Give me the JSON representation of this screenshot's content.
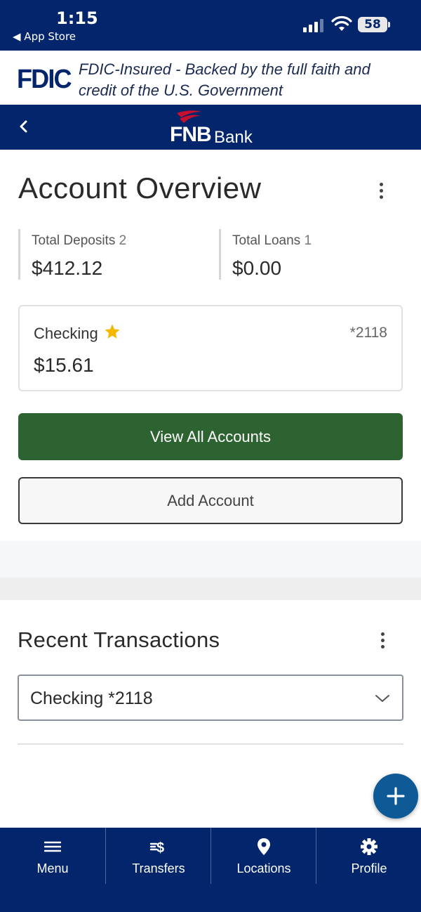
{
  "status_bar": {
    "time": "1:15",
    "back_label": "◀ App Store",
    "battery": "58"
  },
  "fdic": {
    "logo": "FDIC",
    "text": "FDIC-Insured - Backed by the full faith and credit of the U.S. Government"
  },
  "header": {
    "brand_primary": "FNB",
    "brand_secondary": "Bank"
  },
  "overview": {
    "title": "Account Overview",
    "deposits": {
      "label": "Total Deposits",
      "count": "2",
      "value": "$412.12"
    },
    "loans": {
      "label": "Total Loans",
      "count": "1",
      "value": "$0.00"
    },
    "account": {
      "name": "Checking",
      "number": "*2118",
      "balance": "$15.61",
      "favorite": true
    },
    "view_all_label": "View All Accounts",
    "add_account_label": "Add Account"
  },
  "recent": {
    "title": "Recent Transactions",
    "selected_account": "Checking *2118"
  },
  "tabs": [
    {
      "label": "Menu",
      "icon": "menu-icon"
    },
    {
      "label": "Transfers",
      "icon": "transfers-icon"
    },
    {
      "label": "Locations",
      "icon": "location-pin-icon"
    },
    {
      "label": "Profile",
      "icon": "gear-icon"
    }
  ],
  "colors": {
    "navy": "#03256c",
    "green_button": "#2d6331",
    "fab_blue": "#0d5a96",
    "brand_red": "#c8102e",
    "star": "#f5b800"
  }
}
